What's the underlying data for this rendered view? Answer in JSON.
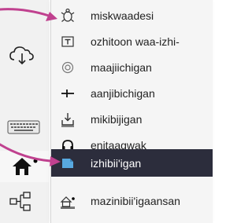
{
  "menu": {
    "items": [
      {
        "label": "miskwaadesi",
        "icon": "turtle-icon",
        "selected": false
      },
      {
        "label": "ozhitoon waa-izhi-",
        "icon": "text-box-icon",
        "selected": false
      },
      {
        "label": "maajiichigan",
        "icon": "record-target-icon",
        "selected": false
      },
      {
        "label": "aanjibichigan",
        "icon": "adjust-slider-icon",
        "selected": false
      },
      {
        "label": "mikibijigan",
        "icon": "download-tray-icon",
        "selected": false
      },
      {
        "label": "enitaagwak",
        "icon": "headphones-icon",
        "selected": false
      },
      {
        "label": "izhibii'igan",
        "icon": "document-folded-icon",
        "selected": true
      },
      {
        "label": "mazinibii'igaansan",
        "icon": "image-scene-icon",
        "selected": false
      }
    ]
  },
  "toolbar": {
    "icons": [
      "cloud-download-icon",
      "keyboard-icon",
      "home-icon",
      "diagram-icon"
    ]
  },
  "colors": {
    "accent_pointer": "#c0418f",
    "selected_row_bg": "#2c2d3c",
    "selected_icon": "#58a9e0",
    "home_dot": "#000000"
  }
}
